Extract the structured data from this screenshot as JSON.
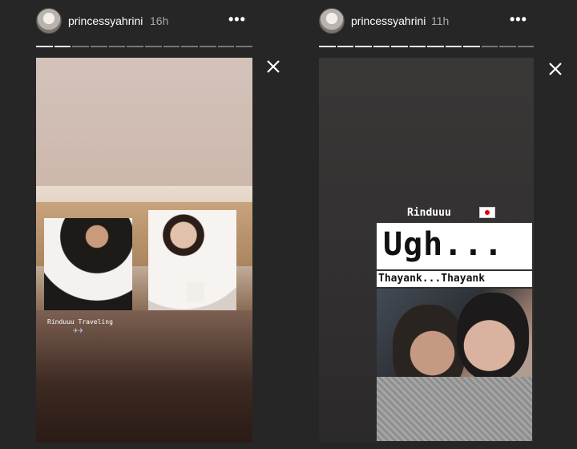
{
  "left_story": {
    "username": "princessyahrini",
    "time": "16h",
    "more_label": "•••",
    "progress_total": 12,
    "progress_completed": 2,
    "caption": "Rinduuu Traveling",
    "emoji": "✈✈"
  },
  "right_story": {
    "username": "princessyahrini",
    "time": "11h",
    "more_label": "•••",
    "progress_total": 12,
    "progress_completed": 9,
    "sticker_text": "Rinduuu",
    "headline": "Ugh...",
    "subline": "Thayank...Thayank"
  },
  "colors": {
    "background": "#262626",
    "progress_done": "#eeeeee",
    "progress_pending": "#777777"
  },
  "icons": {
    "close": "close-icon",
    "more": "more-options-icon",
    "avatar": "profile-avatar"
  }
}
